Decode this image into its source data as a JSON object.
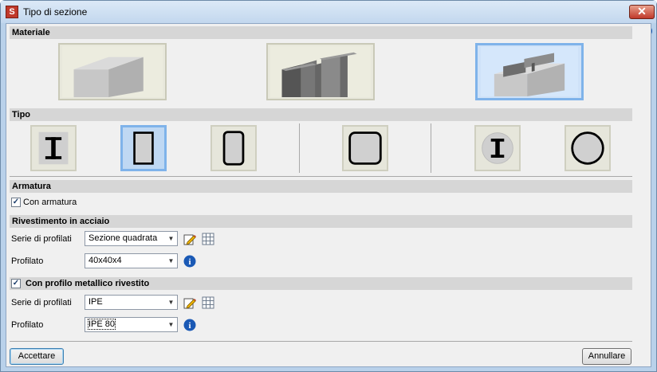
{
  "window": {
    "title": "Tipo di sezione",
    "close_glyph": "✕",
    "help_glyph": "?"
  },
  "materiale": {
    "header": "Materiale",
    "options": [
      {
        "name": "calcestruzzo",
        "selected": false
      },
      {
        "name": "acciaio",
        "selected": false
      },
      {
        "name": "misto",
        "selected": true
      }
    ]
  },
  "tipo": {
    "header": "Tipo",
    "options": [
      {
        "name": "profilo-I-rivestito",
        "selected": false
      },
      {
        "name": "rettangolare",
        "selected": true
      },
      {
        "name": "rettangolare-arrotondata",
        "selected": false
      },
      {
        "name": "quadrata-arrotondata",
        "selected": false
      },
      {
        "name": "circolare-con-I",
        "selected": false
      },
      {
        "name": "circolare",
        "selected": false
      }
    ]
  },
  "armatura": {
    "header": "Armatura",
    "checkbox_label": "Con armatura",
    "checked": true
  },
  "rivestimento": {
    "header": "Rivestimento in acciaio",
    "serie_label": "Serie di profilati",
    "serie_value": "Sezione quadrata",
    "profilato_label": "Profilato",
    "profilato_value": "40x40x4"
  },
  "profilo": {
    "header": "Con profilo metallico rivestito",
    "checked": true,
    "serie_label": "Serie di profilati",
    "serie_value": "IPE",
    "profilato_label": "Profilato",
    "profilato_value": "IPE 80"
  },
  "buttons": {
    "ok": "Accettare",
    "cancel": "Annullare"
  },
  "icons": {
    "arrow": "▼",
    "info": "i",
    "check": "✓",
    "app": "S"
  },
  "colors": {
    "selected_border": "#7fb3ea",
    "titlebar": "#c2d7ee",
    "close": "#c0392b",
    "info": "#1a59b5"
  }
}
